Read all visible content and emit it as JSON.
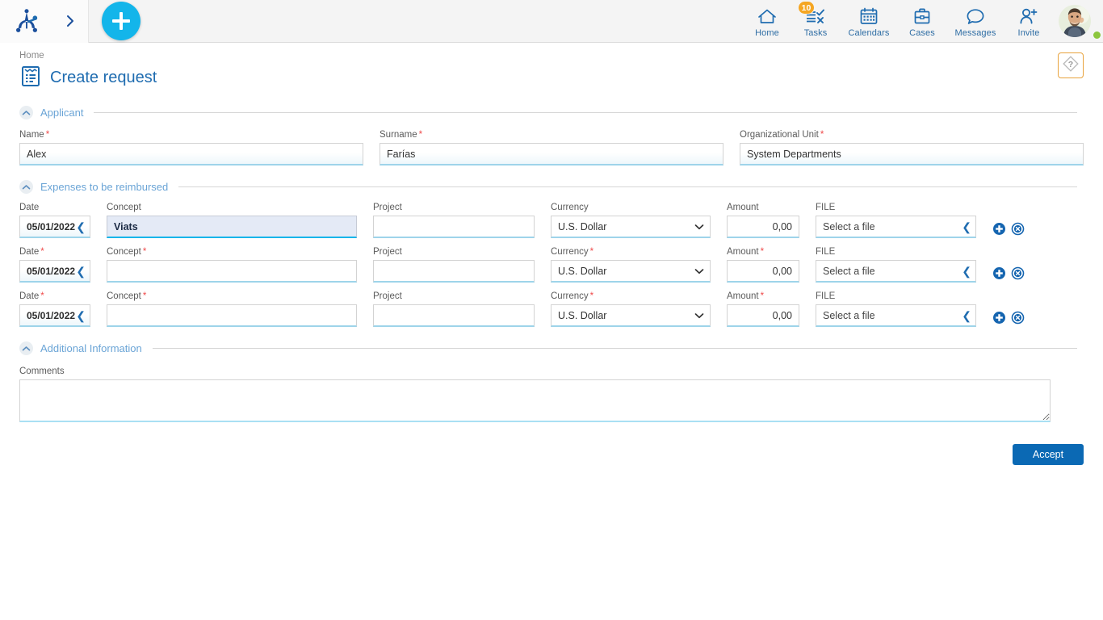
{
  "topbar": {
    "logo_name": "app-logo",
    "expand_arrow": "›",
    "new_button_label": "+",
    "nav": [
      {
        "id": "home",
        "label": "Home",
        "icon": "home-icon",
        "badge": null
      },
      {
        "id": "tasks",
        "label": "Tasks",
        "icon": "tasks-icon",
        "badge": "10"
      },
      {
        "id": "calendars",
        "label": "Calendars",
        "icon": "calendar-icon",
        "badge": null
      },
      {
        "id": "cases",
        "label": "Cases",
        "icon": "briefcase-icon",
        "badge": null
      },
      {
        "id": "messages",
        "label": "Messages",
        "icon": "chat-icon",
        "badge": null
      },
      {
        "id": "invite",
        "label": "Invite",
        "icon": "person-add-icon",
        "badge": null
      }
    ],
    "avatar_name": "user-avatar",
    "status": "online"
  },
  "page": {
    "breadcrumb": "Home",
    "title": "Create request",
    "title_icon": "form-document-icon",
    "help_icon": "help-question-icon"
  },
  "sections": {
    "applicant": {
      "label": "Applicant",
      "collapse_icon": "chevron-up-icon",
      "fields": [
        {
          "label": "Name",
          "required": true,
          "value": "Alex"
        },
        {
          "label": "Surname",
          "required": true,
          "value": "Farías"
        },
        {
          "label": "Organizational Unit",
          "required": true,
          "value": "System Departments"
        }
      ]
    },
    "expenses": {
      "label": "Expenses to be reimbursed",
      "collapse_icon": "chevron-up-icon",
      "columns": {
        "date": "Date",
        "concept": "Concept",
        "project": "Project",
        "currency": "Currency",
        "amount": "Amount",
        "file": "FILE"
      },
      "add_icon": "add-row-icon",
      "remove_icon": "remove-row-icon",
      "currency_options": [
        "U.S. Dollar"
      ],
      "rows": [
        {
          "required": false,
          "date": "05/01/2022",
          "concept": "Viats",
          "concept_focused": true,
          "project": "",
          "currency": "U.S. Dollar",
          "amount": "0,00",
          "file": "Select a file"
        },
        {
          "required": true,
          "date": "05/01/2022",
          "concept": "",
          "concept_focused": false,
          "project": "",
          "currency": "U.S. Dollar",
          "amount": "0,00",
          "file": "Select a file"
        },
        {
          "required": true,
          "date": "05/01/2022",
          "concept": "",
          "concept_focused": false,
          "project": "",
          "currency": "U.S. Dollar",
          "amount": "0,00",
          "file": "Select a file"
        }
      ]
    },
    "additional": {
      "label": "Additional Information",
      "collapse_icon": "chevron-up-icon",
      "comments_label": "Comments",
      "comments_value": ""
    }
  },
  "footer": {
    "accept_label": "Accept"
  },
  "colors": {
    "accent_blue": "#1f6cb0",
    "cyan": "#13b5ea",
    "section_label": "#6aa4d6",
    "required_red": "#ef4a4a",
    "badge_orange": "#f5a623",
    "accept_blue": "#0b69b4",
    "status_green": "#8cc63e",
    "help_border": "#e8a33d"
  }
}
